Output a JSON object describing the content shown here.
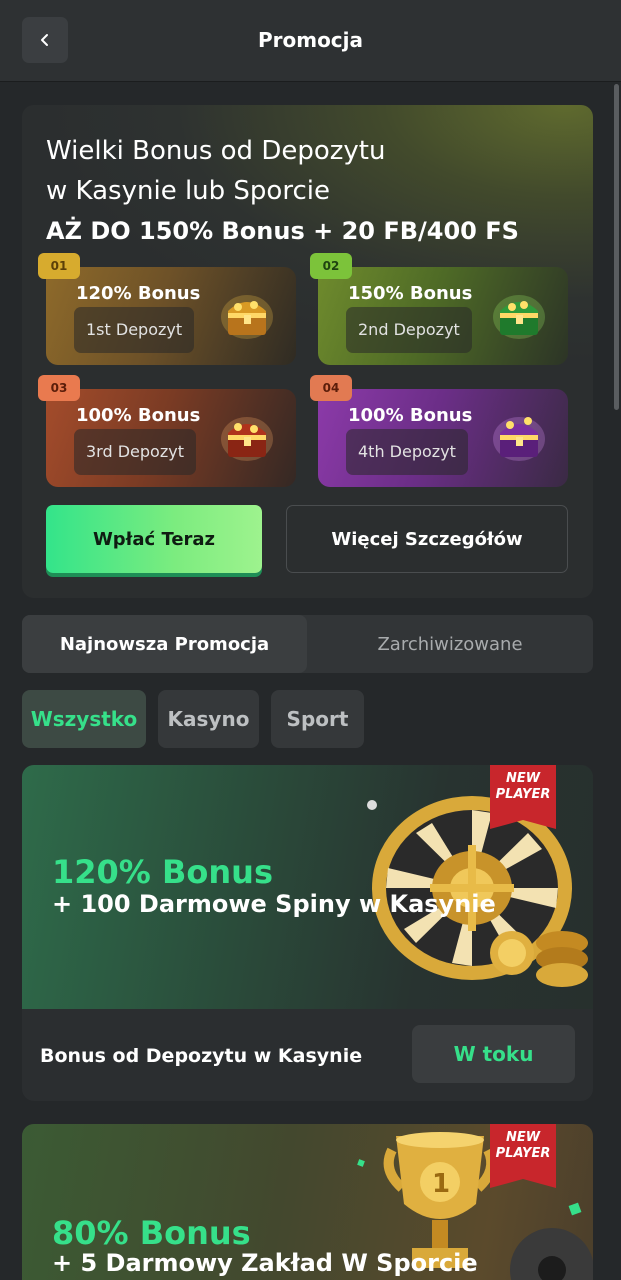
{
  "header": {
    "title": "Promocja"
  },
  "hero": {
    "line1": "Wielki Bonus od Depozytu",
    "line2": "w Kasynie lub Sporcie",
    "line3": "AŻ DO 150% Bonus + 20 FB/400 FS",
    "tiles": [
      {
        "badge": "01",
        "amount": "120% Bonus",
        "label": "1st Depozyt"
      },
      {
        "badge": "02",
        "amount": "150% Bonus",
        "label": "2nd Depozyt"
      },
      {
        "badge": "03",
        "amount": "100% Bonus",
        "label": "3rd Depozyt"
      },
      {
        "badge": "04",
        "amount": "100% Bonus",
        "label": "4th Depozyt"
      }
    ],
    "deposit_button": "Wpłać Teraz",
    "details_button": "Więcej Szczegółów"
  },
  "tabs": {
    "active": "Najnowsza Promocja",
    "inactive": "Zarchiwizowane"
  },
  "filters": {
    "all": "Wszystko",
    "casino": "Kasyno",
    "sport": "Sport"
  },
  "promos": [
    {
      "badge_line1": "NEW",
      "badge_line2": "PLAYER",
      "amount": "120% Bonus",
      "description": "+ 100 Darmowe Spiny w Kasynie",
      "title": "Bonus od Depozytu w Kasynie",
      "status": "W toku"
    },
    {
      "badge_line1": "NEW",
      "badge_line2": "PLAYER",
      "amount": "80% Bonus",
      "description": "+ 5 Darmowy Zakład W Sporcie"
    }
  ],
  "colors": {
    "accent": "#36e08a",
    "background": "#25282a",
    "badge_red": "#c8262c"
  }
}
